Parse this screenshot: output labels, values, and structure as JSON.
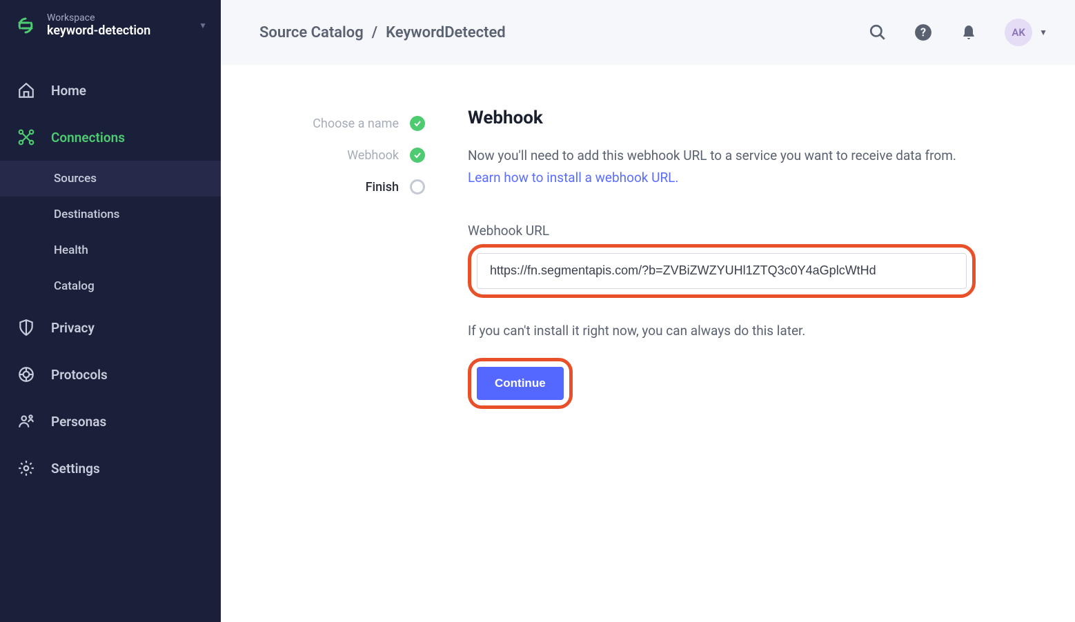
{
  "workspace": {
    "label": "Workspace",
    "name": "keyword-detection"
  },
  "sidebar": {
    "items": [
      {
        "label": "Home"
      },
      {
        "label": "Connections"
      },
      {
        "label": "Privacy"
      },
      {
        "label": "Protocols"
      },
      {
        "label": "Personas"
      },
      {
        "label": "Settings"
      }
    ],
    "subitems": [
      {
        "label": "Sources"
      },
      {
        "label": "Destinations"
      },
      {
        "label": "Health"
      },
      {
        "label": "Catalog"
      }
    ]
  },
  "breadcrumb": {
    "item1": "Source Catalog",
    "item2": "KeywordDetected"
  },
  "avatar": "AK",
  "steps": [
    {
      "label": "Choose a name"
    },
    {
      "label": "Webhook"
    },
    {
      "label": "Finish"
    }
  ],
  "panel": {
    "title": "Webhook",
    "desc": "Now you'll need to add this webhook URL to a service you want to receive data from. ",
    "link_text": "Learn how to install a webhook URL.",
    "field_label": "Webhook URL",
    "url_value": "https://fn.segmentapis.com/?b=ZVBiZWZYUHl1ZTQ3c0Y4aGplcWtHd",
    "later_text": "If you can't install it right now, you can always do this later.",
    "continue_label": "Continue"
  }
}
